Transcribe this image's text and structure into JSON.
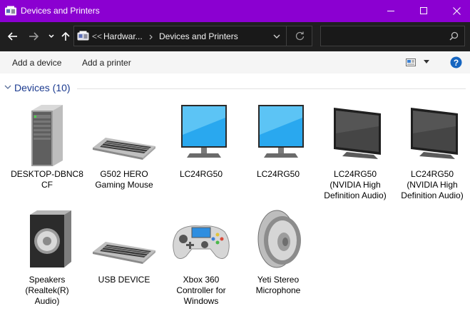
{
  "window": {
    "title": "Devices and Printers"
  },
  "address": {
    "overflow": "<<",
    "crumbs": [
      "Hardwar...",
      "Devices and Printers"
    ]
  },
  "search": {
    "placeholder": ""
  },
  "commands": {
    "add_device": "Add a device",
    "add_printer": "Add a printer"
  },
  "group": {
    "title": "Devices (10)"
  },
  "devices": [
    {
      "label": "DESKTOP-DBNC8\nCF",
      "icon": "computer-tower-icon"
    },
    {
      "label": "G502 HERO\nGaming Mouse",
      "icon": "keyboard-icon"
    },
    {
      "label": "LC24RG50",
      "icon": "monitor-icon"
    },
    {
      "label": "LC24RG50",
      "icon": "monitor-icon"
    },
    {
      "label": "LC24RG50\n(NVIDIA High\nDefinition Audio)",
      "icon": "dark-monitor-icon"
    },
    {
      "label": "LC24RG50\n(NVIDIA High\nDefinition Audio)",
      "icon": "dark-monitor-icon"
    },
    {
      "label": "Speakers\n(Realtek(R)\nAudio)",
      "icon": "speaker-icon"
    },
    {
      "label": "USB DEVICE",
      "icon": "keyboard-icon"
    },
    {
      "label": "Xbox 360\nController for\nWindows",
      "icon": "gamepad-icon"
    },
    {
      "label": "Yeti Stereo\nMicrophone",
      "icon": "round-speaker-icon"
    }
  ],
  "colors": {
    "titlebar": "#8b00d1",
    "addressbar": "#1f1f1f",
    "group_title": "#1b3a8f",
    "help": "#1565c0"
  }
}
